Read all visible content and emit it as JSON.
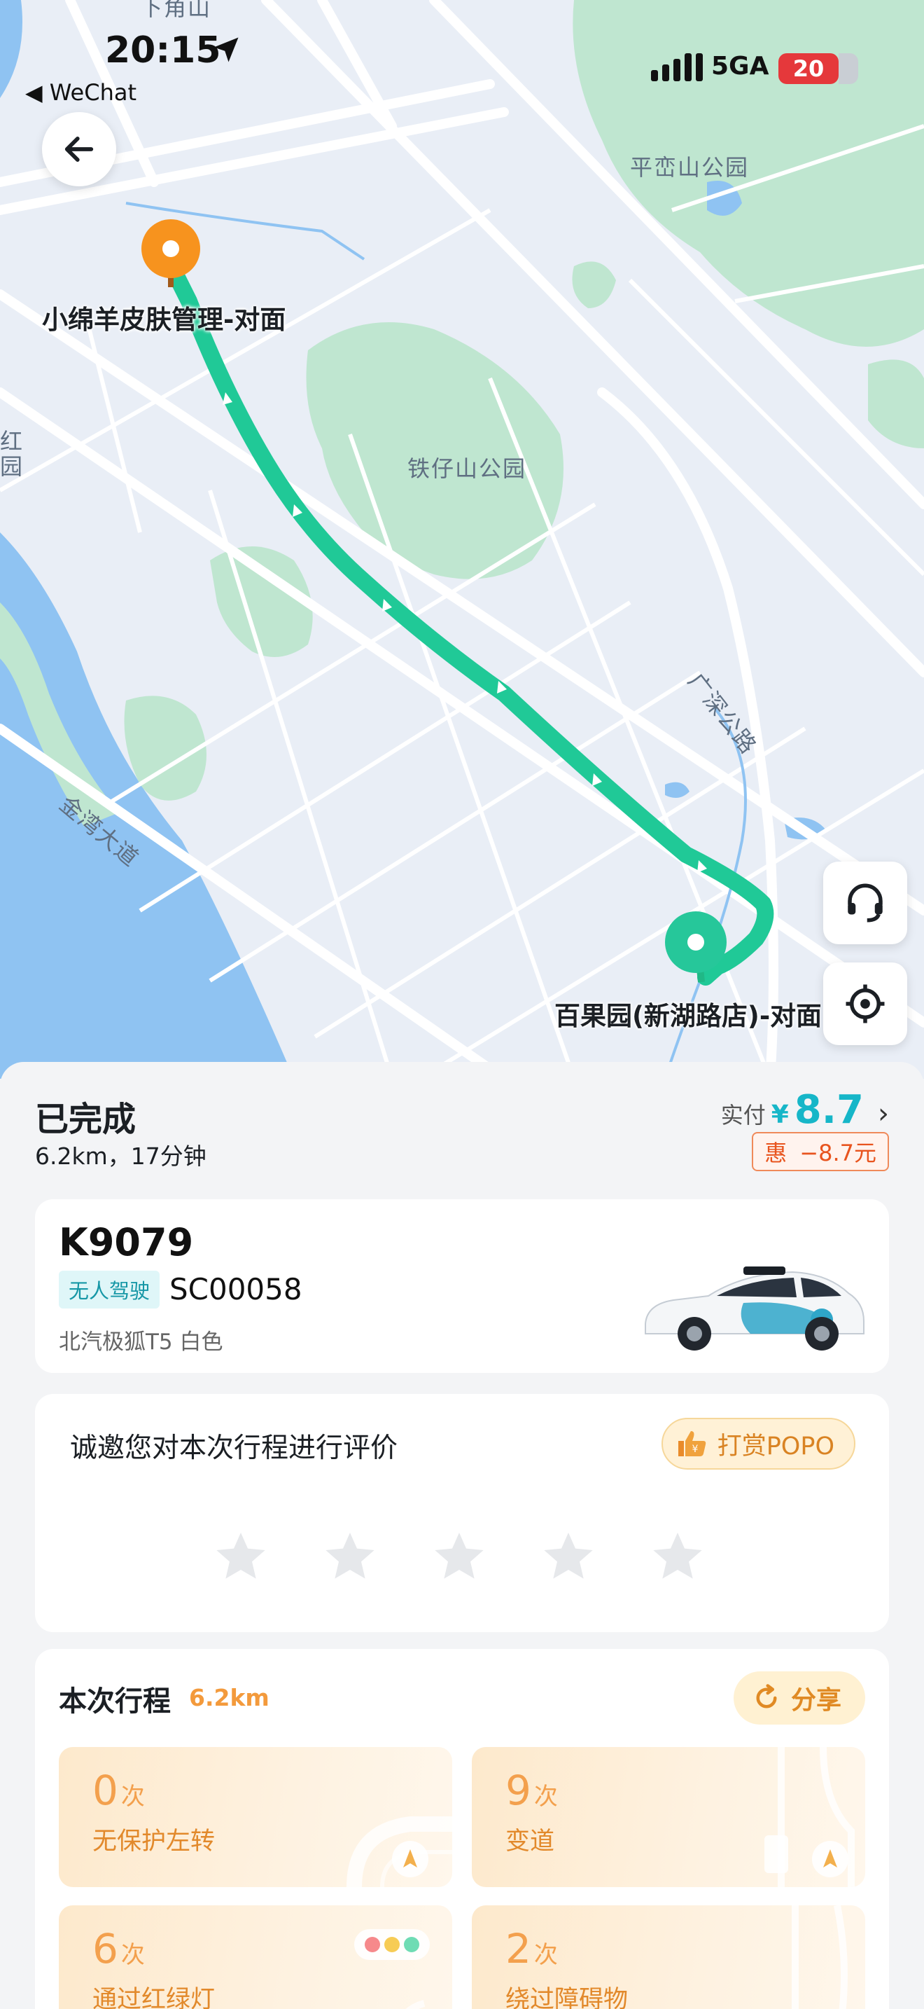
{
  "status_bar": {
    "time": "20:15",
    "back_app": "◀ WeChat",
    "network": "5GA",
    "battery": "20"
  },
  "map": {
    "labels": {
      "top_edge": "下角山",
      "park_1": "平峦山公园",
      "park_2": "铁仔山公园",
      "road_1": "广深公路",
      "road_2": "金湾大道",
      "edge_left": "红\n园"
    },
    "origin": "小绵羊皮肤管理-对面",
    "destination": "百果园(新湖路店)-对面",
    "route_color": "#20c997",
    "origin_color": "#f7931e"
  },
  "trip_summary": {
    "status": "已完成",
    "meta": "6.2km，17分钟",
    "paid_label": "实付",
    "currency": "¥",
    "paid_amount": "8.7",
    "discount_label": "惠",
    "discount_value": "−8.7元"
  },
  "vehicle": {
    "plate": "K9079",
    "tag": "无人驾驶",
    "code": "SC00058",
    "model": "北汽极狐T5 白色"
  },
  "rating": {
    "prompt": "诚邀您对本次行程进行评价",
    "tip_label": "打赏POPO",
    "stars": 5
  },
  "trip_stats": {
    "title": "本次行程",
    "distance": "6.2km",
    "share_label": "分享",
    "unit": "次",
    "items": [
      {
        "count": "0",
        "label": "无保护左转"
      },
      {
        "count": "9",
        "label": "变道"
      },
      {
        "count": "6",
        "label": "通过红绿灯"
      },
      {
        "count": "2",
        "label": "绕过障碍物"
      }
    ]
  },
  "colors": {
    "accent": "#16b6c8",
    "orange": "#f3a04d",
    "discount": "#e8541e"
  }
}
